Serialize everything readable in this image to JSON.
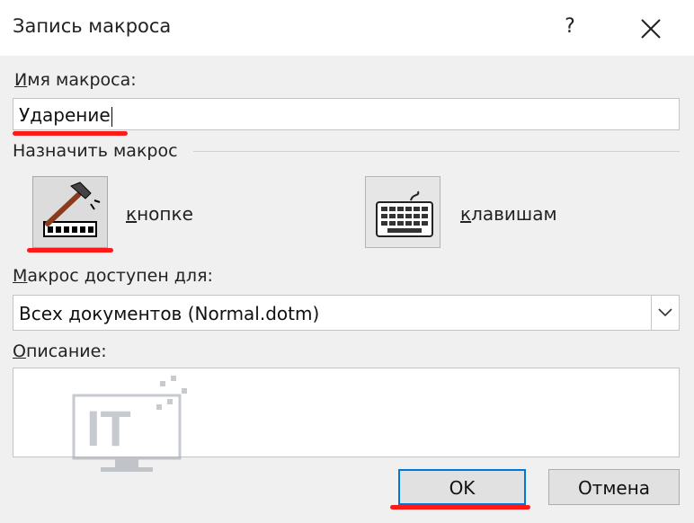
{
  "window": {
    "title": "Запись макроса",
    "help_label": "?"
  },
  "macro_name": {
    "label_accel": "И",
    "label_rest": "мя макроса:",
    "value": "Ударение"
  },
  "assign": {
    "label": "Назначить макрос",
    "button_option": {
      "accel": "к",
      "rest": "нопке",
      "icon": "hammer-toolbar-icon"
    },
    "keys_option": {
      "accel": "к",
      "rest": "лавишам",
      "icon": "keyboard-icon"
    }
  },
  "available_for": {
    "label_accel": "М",
    "label_rest": "акрос доступен для:",
    "selected": "Всех документов (Normal.dotm)"
  },
  "description": {
    "label_accel": "О",
    "label_rest": "писание:",
    "value": ""
  },
  "buttons": {
    "ok_label": "OK",
    "cancel_label": "Отмена"
  },
  "colors": {
    "annotation": "#ff1a1a",
    "focus_border": "#0078d7",
    "dialog_bg": "#f0f0f0"
  },
  "watermark": {
    "text": "IT"
  }
}
